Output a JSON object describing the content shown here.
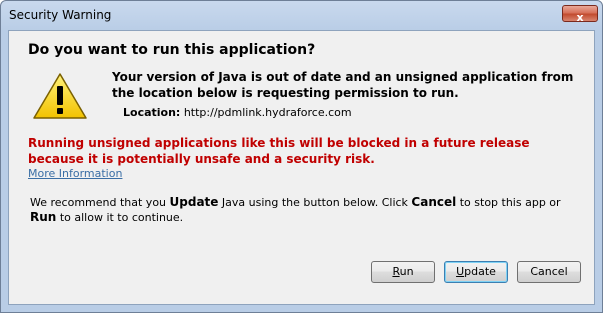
{
  "window": {
    "title": "Security Warning",
    "close_glyph": "x"
  },
  "dialog": {
    "heading": "Do you want to run this application?",
    "description": "Your version of Java is out of date and an unsigned application from the location below is requesting permission to run.",
    "location_label": "Location:",
    "location_value": "http://pdmlink.hydraforce.com",
    "warning": "Running unsigned applications like this will be blocked in a future release because it is potentially unsafe and a security risk.",
    "more_info": "More Information",
    "recommend_1": "We recommend that you ",
    "recommend_update": "Update",
    "recommend_2": " Java using the button below. Click ",
    "recommend_cancel": "Cancel",
    "recommend_3": " to stop this app or ",
    "recommend_run": "Run",
    "recommend_4": " to allow it to continue."
  },
  "buttons": {
    "run_access": "R",
    "run_rest": "un",
    "update_access": "U",
    "update_rest": "pdate",
    "cancel": "Cancel"
  },
  "colors": {
    "warning_text": "#c00000",
    "link": "#3a6ea5",
    "icon_fill": "#f5d000"
  },
  "icons": {
    "warning": "warning-triangle-icon",
    "close": "close-icon"
  }
}
